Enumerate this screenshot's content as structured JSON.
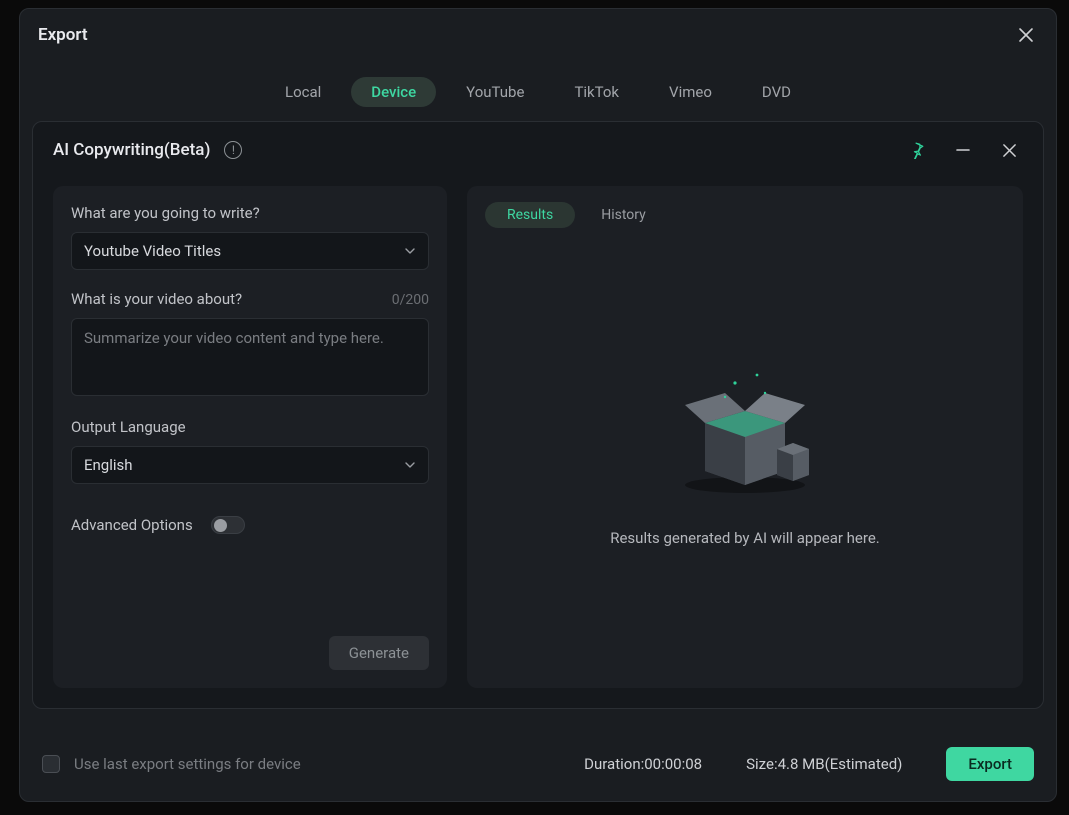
{
  "header": {
    "title": "Export"
  },
  "tabs": {
    "items": [
      "Local",
      "Device",
      "YouTube",
      "TikTok",
      "Vimeo",
      "DVD"
    ],
    "active_index": 1
  },
  "ai_panel": {
    "title": "AI Copywriting(Beta)",
    "left": {
      "write_label": "What are you going to write?",
      "write_select_value": "Youtube Video Titles",
      "about_label": "What is your video about?",
      "about_counter": "0/200",
      "about_placeholder": "Summarize your video content and type here.",
      "lang_label": "Output Language",
      "lang_select_value": "English",
      "advanced_label": "Advanced Options",
      "generate_label": "Generate"
    },
    "right": {
      "tabs": {
        "results": "Results",
        "history": "History"
      },
      "placeholder": "Results generated by AI will appear here."
    }
  },
  "footer": {
    "use_last_label": "Use last export settings for device",
    "duration_label": "Duration:",
    "duration_value": "00:00:08",
    "size_label": "Size:",
    "size_value": "4.8 MB",
    "estimated_suffix": "(Estimated)",
    "export_label": "Export"
  },
  "colors": {
    "accent": "#3fd7a1",
    "panel": "#1c1f24",
    "bg": "#1a1d21"
  }
}
